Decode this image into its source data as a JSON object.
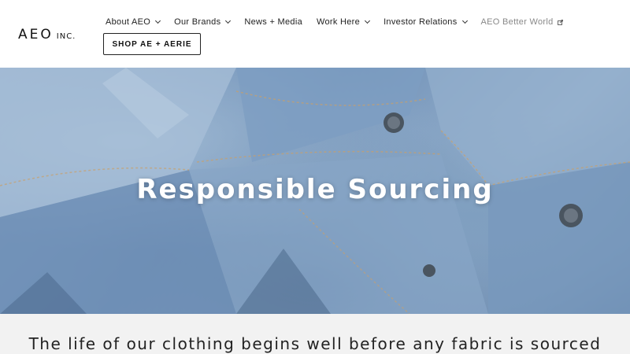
{
  "header": {
    "logo_main": "AEO",
    "logo_sub": "INC.",
    "nav": [
      {
        "label": "About AEO",
        "has_dropdown": true
      },
      {
        "label": "Our Brands",
        "has_dropdown": true
      },
      {
        "label": "News + Media",
        "has_dropdown": false
      },
      {
        "label": "Work Here",
        "has_dropdown": true
      },
      {
        "label": "Investor Relations",
        "has_dropdown": true
      },
      {
        "label": "AEO Better World",
        "has_dropdown": false,
        "icon": "external-link-icon"
      }
    ],
    "shop_button": "SHOP AE + AERIE"
  },
  "hero": {
    "title": "Responsible Sourcing",
    "image": "denim-jackets"
  },
  "intro": {
    "text": "The life of our clothing begins well before any fabric is sourced"
  },
  "colors": {
    "hero_blue": "#7f9fc0",
    "intro_bg": "#f2f2f2",
    "text": "#222222",
    "muted_nav": "#888888"
  }
}
